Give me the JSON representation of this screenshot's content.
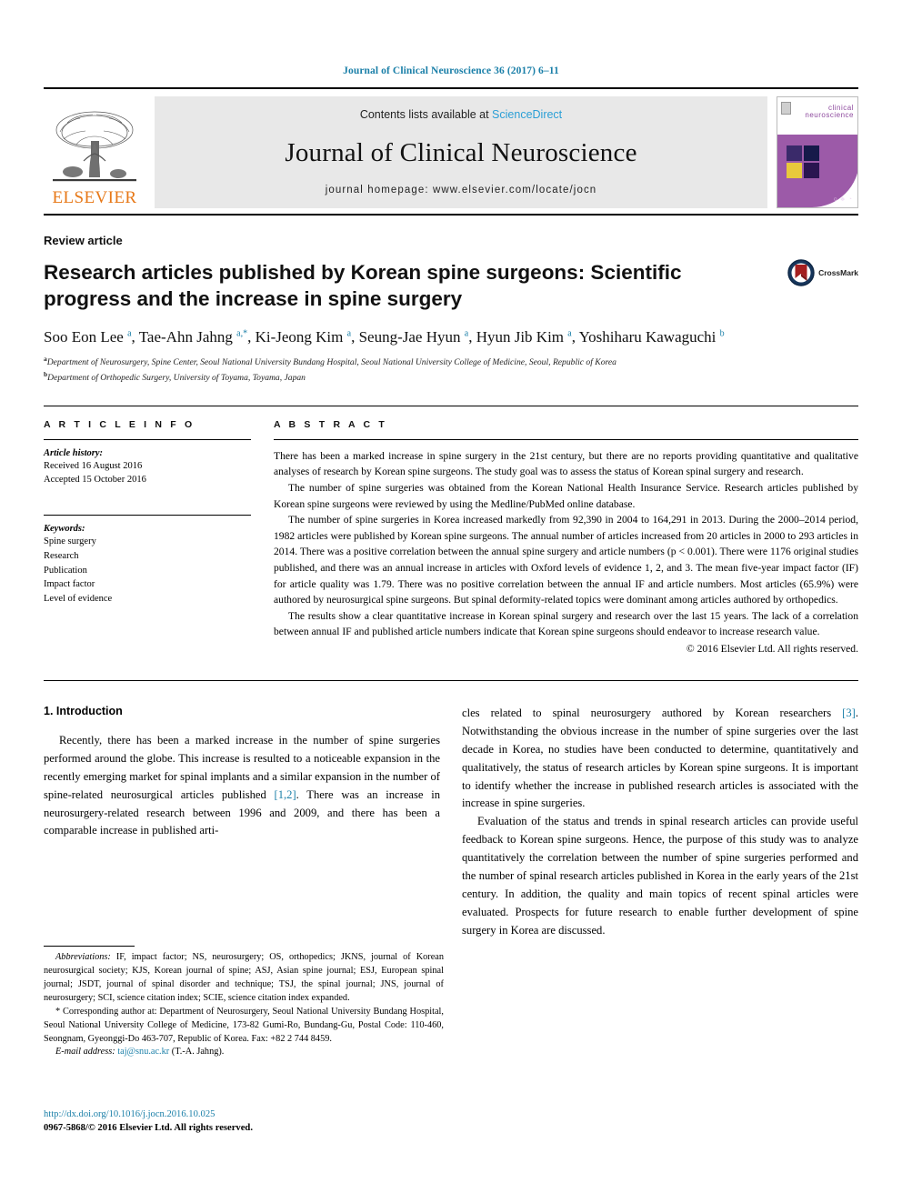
{
  "running_head": "Journal of Clinical Neuroscience 36 (2017) 6–11",
  "masthead": {
    "contents_prefix": "Contents lists available at ",
    "sciencedirect": "ScienceDirect",
    "journal_name": "Journal of Clinical Neuroscience",
    "homepage": "journal homepage: www.elsevier.com/locate/jocn",
    "publisher_wordmark": "ELSEVIER",
    "cover": {
      "title_line1": "clinical",
      "title_line2": "neuroscience",
      "foot_marks": "○ ♣ ◔"
    }
  },
  "article": {
    "type": "Review article",
    "title": "Research articles published by Korean spine surgeons: Scientific progress and the increase in spine surgery",
    "crossmark_label": "CrossMark",
    "authors_html": "Soo Eon Lee <sup>a</sup>, Tae-Ahn Jahng <sup>a,*</sup>, Ki-Jeong Kim <sup>a</sup>, Seung-Jae Hyun <sup>a</sup>, Hyun Jib Kim <sup>a</sup>, Yoshiharu Kawaguchi <sup>b</sup>",
    "affiliations": [
      {
        "marker": "a",
        "text": "Department of Neurosurgery, Spine Center, Seoul National University Bundang Hospital, Seoul National University College of Medicine, Seoul, Republic of Korea"
      },
      {
        "marker": "b",
        "text": "Department of Orthopedic Surgery, University of Toyama, Toyama, Japan"
      }
    ]
  },
  "article_info": {
    "heading": "A R T I C L E   I N F O",
    "history_label": "Article history:",
    "received": "Received 16 August 2016",
    "accepted": "Accepted 15 October 2016",
    "keywords_label": "Keywords:",
    "keywords": [
      "Spine surgery",
      "Research",
      "Publication",
      "Impact factor",
      "Level of evidence"
    ]
  },
  "abstract": {
    "heading": "A B S T R A C T",
    "paragraphs": [
      "There has been a marked increase in spine surgery in the 21st century, but there are no reports providing quantitative and qualitative analyses of research by Korean spine surgeons. The study goal was to assess the status of Korean spinal surgery and research.",
      "The number of spine surgeries was obtained from the Korean National Health Insurance Service. Research articles published by Korean spine surgeons were reviewed by using the Medline/PubMed online database.",
      "The number of spine surgeries in Korea increased markedly from 92,390 in 2004 to 164,291 in 2013. During the 2000–2014 period, 1982 articles were published by Korean spine surgeons. The annual number of articles increased from 20 articles in 2000 to 293 articles in 2014. There was a positive correlation between the annual spine surgery and article numbers (p < 0.001). There were 1176 original studies published, and there was an annual increase in articles with Oxford levels of evidence 1, 2, and 3. The mean five-year impact factor (IF) for article quality was 1.79. There was no positive correlation between the annual IF and article numbers. Most articles (65.9%) were authored by neurosurgical spine surgeons. But spinal deformity-related topics were dominant among articles authored by orthopedics.",
      "The results show a clear quantitative increase in Korean spinal surgery and research over the last 15 years. The lack of a correlation between annual IF and published article numbers indicate that Korean spine surgeons should endeavor to increase research value."
    ],
    "rights": "© 2016 Elsevier Ltd. All rights reserved."
  },
  "introduction": {
    "heading": "1. Introduction",
    "left_paragraph": "Recently, there has been a marked increase in the number of spine surgeries performed around the globe. This increase is resulted to a noticeable expansion in the recently emerging market for spinal implants and a similar expansion in the number of spine-related neurosurgical articles published [1,2]. There was an increase in neurosurgery-related research between 1996 and 2009, and there has been a comparable increase in published arti-",
    "right_paragraph_1": "cles related to spinal neurosurgery authored by Korean researchers [3]. Notwithstanding the obvious increase in the number of spine surgeries over the last decade in Korea, no studies have been conducted to determine, quantitatively and qualitatively, the status of research articles by Korean spine surgeons. It is important to identify whether the increase in published research articles is associated with the increase in spine surgeries.",
    "right_paragraph_2": "Evaluation of the status and trends in spinal research articles can provide useful feedback to Korean spine surgeons. Hence, the purpose of this study was to analyze quantitatively the correlation between the number of spine surgeries performed and the number of spinal research articles published in Korea in the early years of the 21st century. In addition, the quality and main topics of recent spinal articles were evaluated. Prospects for future research to enable further development of spine surgery in Korea are discussed.",
    "citation_1": "[1,2]",
    "citation_2": "[3]"
  },
  "footnotes": {
    "abbreviations_label": "Abbreviations:",
    "abbreviations_text": "IF, impact factor; NS, neurosurgery; OS, orthopedics; JKNS, journal of Korean neurosurgical society; KJS, Korean journal of spine; ASJ, Asian spine journal; ESJ, European spinal journal; JSDT, journal of spinal disorder and technique; TSJ, the spinal journal; JNS, journal of neurosurgery; SCI, science citation index; SCIE, science citation index expanded.",
    "corresponding_text": "* Corresponding author at: Department of Neurosurgery, Seoul National University Bundang Hospital, Seoul National University College of Medicine, 173-82 Gumi-Ro, Bundang-Gu, Postal Code: 110-460, Seongnam, Gyeonggi-Do 463-707, Republic of Korea. Fax: +82 2 744 8459.",
    "email_label": "E-mail address:",
    "email": "taj@snu.ac.kr",
    "email_suffix": "(T.-A. Jahng)."
  },
  "footer": {
    "doi": "http://dx.doi.org/10.1016/j.jocn.2016.10.025",
    "issn_line": "0967-5868/© 2016 Elsevier Ltd. All rights reserved."
  },
  "colors": {
    "link_blue": "#1a7fa8",
    "sciencedirect_blue": "#2a9fd6",
    "elsevier_orange": "#E77817",
    "cover_purple": "#9c5aa8"
  }
}
